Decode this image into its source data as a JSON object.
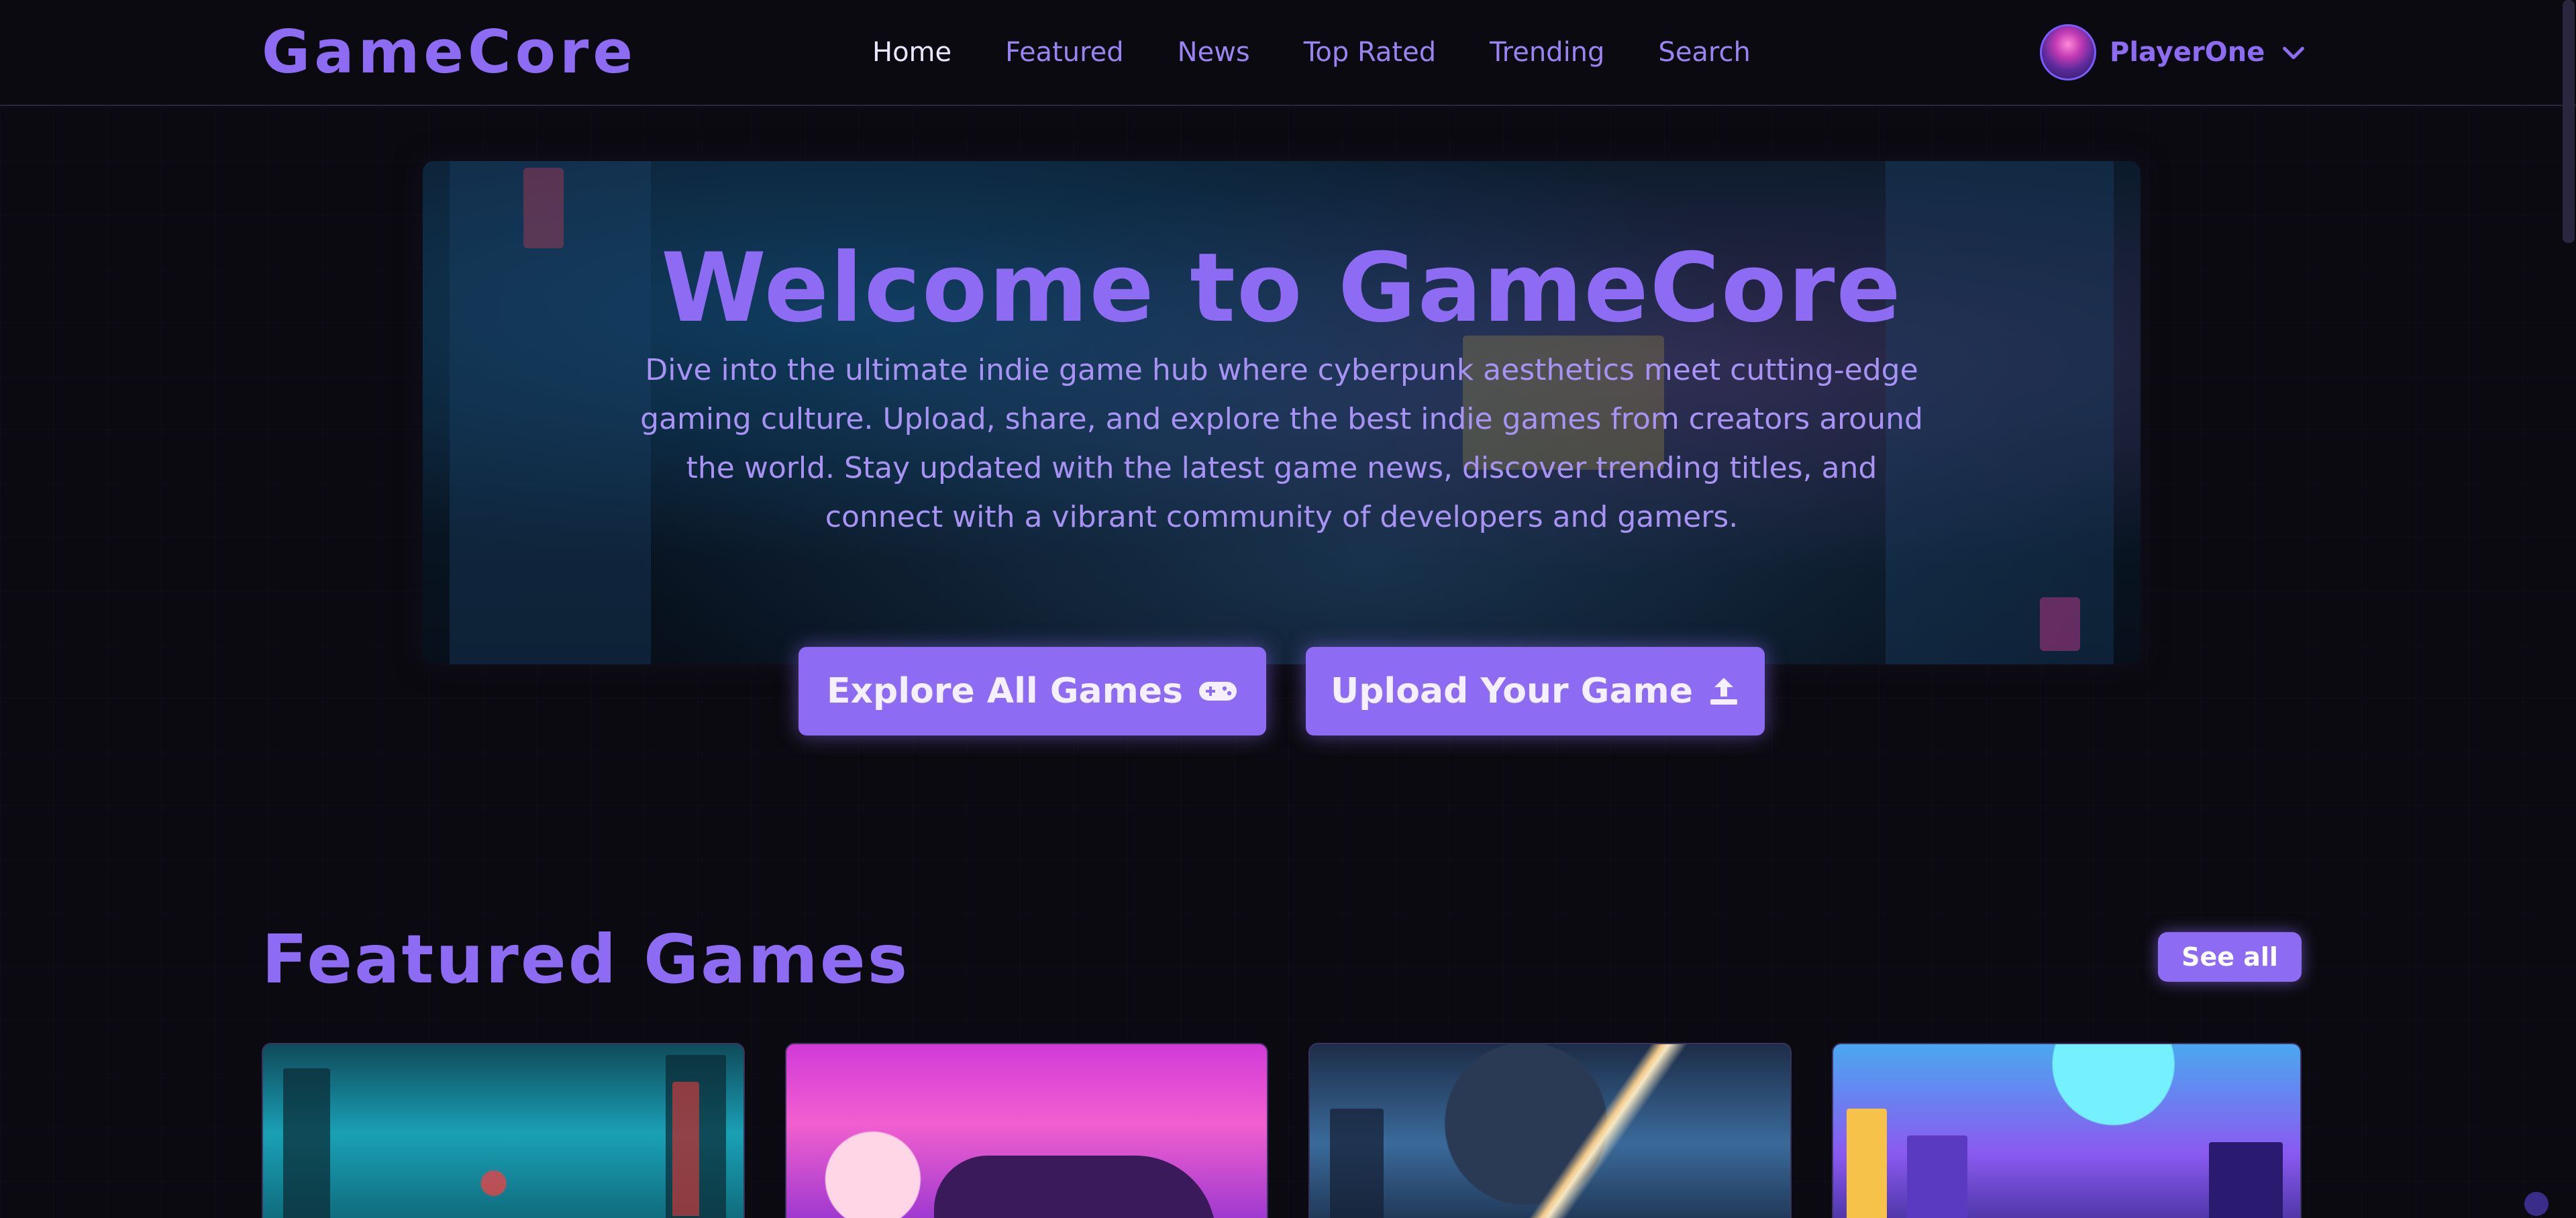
{
  "brand": {
    "logo": "GameCore"
  },
  "nav": {
    "items": [
      {
        "label": "Home",
        "active": true
      },
      {
        "label": "Featured",
        "active": false
      },
      {
        "label": "News",
        "active": false
      },
      {
        "label": "Top Rated",
        "active": false
      },
      {
        "label": "Trending",
        "active": false
      },
      {
        "label": "Search",
        "active": false
      }
    ]
  },
  "user": {
    "name": "PlayerOne"
  },
  "hero": {
    "title": "Welcome to GameCore",
    "description": "Dive into the ultimate indie game hub where cyberpunk aesthetics meet cutting-edge gaming culture. Upload, share, and explore the best indie games from creators around the world. Stay updated with the latest game news, discover trending titles, and connect with a vibrant community of developers and gamers.",
    "explore_label": "Explore All Games",
    "upload_label": "Upload Your Game"
  },
  "featured": {
    "title": "Featured Games",
    "see_all_label": "See all"
  },
  "icons": {
    "explore": "gamepad-icon",
    "upload": "upload-icon",
    "user_menu": "chevron-down-icon"
  },
  "colors": {
    "accent": "#8d6bf2",
    "background": "#0b0a10",
    "nav_active": "#ece6ff"
  }
}
